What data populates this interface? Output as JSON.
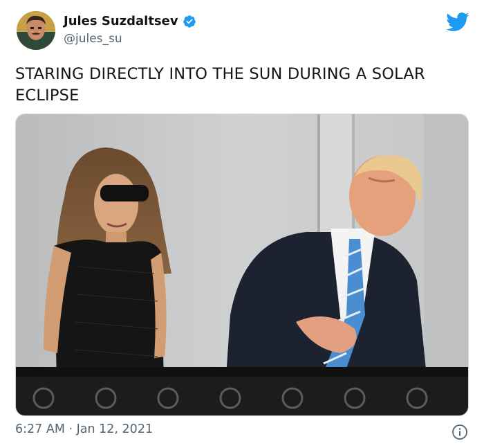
{
  "author": {
    "display_name": "Jules Suzdaltsev",
    "handle": "@jules_su",
    "verified": true
  },
  "tweet": {
    "text": "STARING DIRECTLY INTO THE SUN DURING A SOLAR ECLIPSE",
    "timestamp": "6:27 AM · Jan 12, 2021"
  },
  "icons": {
    "brand": "twitter-bird-icon",
    "verified": "verified-badge-icon",
    "info": "info-icon"
  },
  "colors": {
    "twitter_blue": "#1d9bf0",
    "text_primary": "#0f1419",
    "text_secondary": "#536471"
  }
}
